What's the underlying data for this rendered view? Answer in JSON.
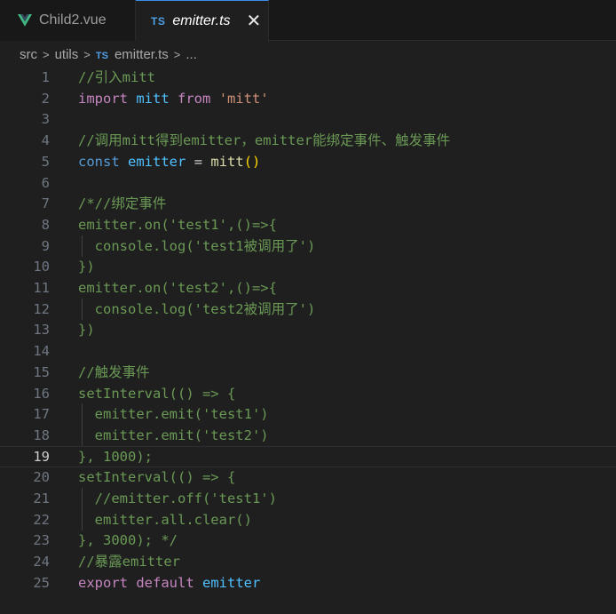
{
  "tabs": [
    {
      "label": "Child2.vue",
      "icon": "vue-icon",
      "active": false
    },
    {
      "label": "emitter.ts",
      "icon": "typescript-icon",
      "active": true,
      "close": "✕"
    }
  ],
  "breadcrumb": {
    "items": [
      "src",
      "utils",
      "emitter.ts",
      "..."
    ],
    "file_badge": "TS",
    "tab_badge": "TS"
  },
  "editor": {
    "active_line": 19,
    "lines": [
      {
        "n": "1",
        "text": "//引入mitt"
      },
      {
        "n": "2",
        "text": "import mitt from 'mitt'"
      },
      {
        "n": "3",
        "text": ""
      },
      {
        "n": "4",
        "text": "//调用mitt得到emitter，emitter能绑定事件、触发事件"
      },
      {
        "n": "5",
        "text": "const emitter = mitt()"
      },
      {
        "n": "6",
        "text": ""
      },
      {
        "n": "7",
        "text": "/*//绑定事件"
      },
      {
        "n": "8",
        "text": "emitter.on('test1',()=>{"
      },
      {
        "n": "9",
        "text": "  console.log('test1被调用了')"
      },
      {
        "n": "10",
        "text": "})"
      },
      {
        "n": "11",
        "text": "emitter.on('test2',()=>{"
      },
      {
        "n": "12",
        "text": "  console.log('test2被调用了')"
      },
      {
        "n": "13",
        "text": "})"
      },
      {
        "n": "14",
        "text": ""
      },
      {
        "n": "15",
        "text": "//触发事件"
      },
      {
        "n": "16",
        "text": "setInterval(() => {"
      },
      {
        "n": "17",
        "text": "  emitter.emit('test1')"
      },
      {
        "n": "18",
        "text": "  emitter.emit('test2')"
      },
      {
        "n": "19",
        "text": "}, 1000);"
      },
      {
        "n": "20",
        "text": "setInterval(() => {"
      },
      {
        "n": "21",
        "text": "  //emitter.off('test1')"
      },
      {
        "n": "22",
        "text": "  emitter.all.clear()"
      },
      {
        "n": "23",
        "text": "}, 3000); */"
      },
      {
        "n": "24",
        "text": "//暴露emitter"
      },
      {
        "n": "25",
        "text": "export default emitter"
      }
    ]
  },
  "colors": {
    "background": "#1f1f1f",
    "comment": "#6a9955",
    "keyword": "#c586c0",
    "declaration": "#569cd6",
    "variable": "#4fc1ff",
    "function": "#dcdcaa",
    "string": "#ce9178",
    "ts_badge": "#4f9fe6",
    "vue_logo": "#41b883"
  }
}
